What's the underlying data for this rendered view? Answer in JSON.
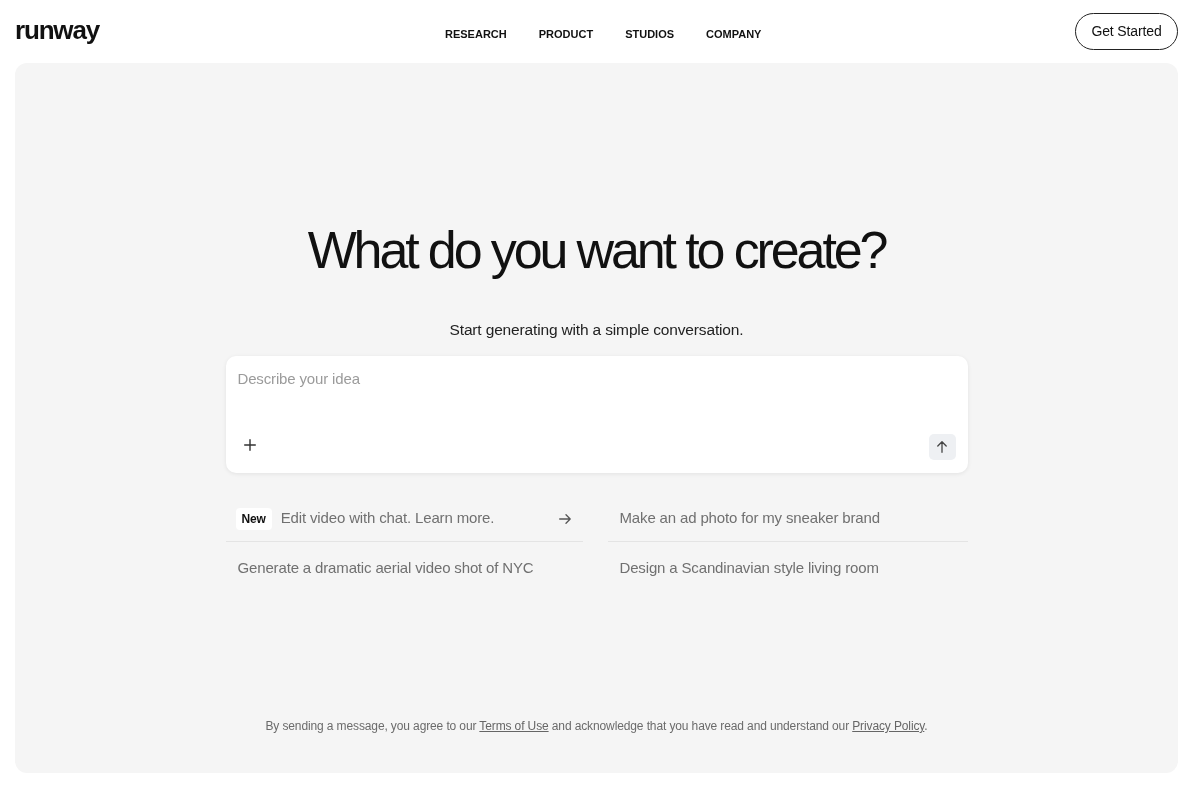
{
  "header": {
    "logo": "runway",
    "nav": [
      "RESEARCH",
      "PRODUCT",
      "STUDIOS",
      "COMPANY"
    ],
    "cta": "Get Started"
  },
  "hero": {
    "title": "What do you want to create?",
    "subtitle": "Start generating with a simple conversation."
  },
  "prompt": {
    "placeholder": "Describe your idea"
  },
  "suggestions": [
    {
      "kind": "feature",
      "badge": "New",
      "text": "Edit video with chat. Learn more."
    },
    {
      "kind": "prompt",
      "text": "Make an ad photo for my sneaker brand"
    },
    {
      "kind": "prompt",
      "text": "Generate a dramatic aerial video shot of NYC"
    },
    {
      "kind": "prompt",
      "text": "Design a Scandinavian style living room"
    }
  ],
  "disclaimer": [
    {
      "kind": "text",
      "text": "By sending a message, you agree to our "
    },
    {
      "kind": "link",
      "text": "Terms of Use"
    },
    {
      "kind": "text",
      "text": " and acknowledge that you have read and understand our "
    },
    {
      "kind": "link",
      "text": "Privacy Policy"
    },
    {
      "kind": "text",
      "text": "."
    }
  ]
}
